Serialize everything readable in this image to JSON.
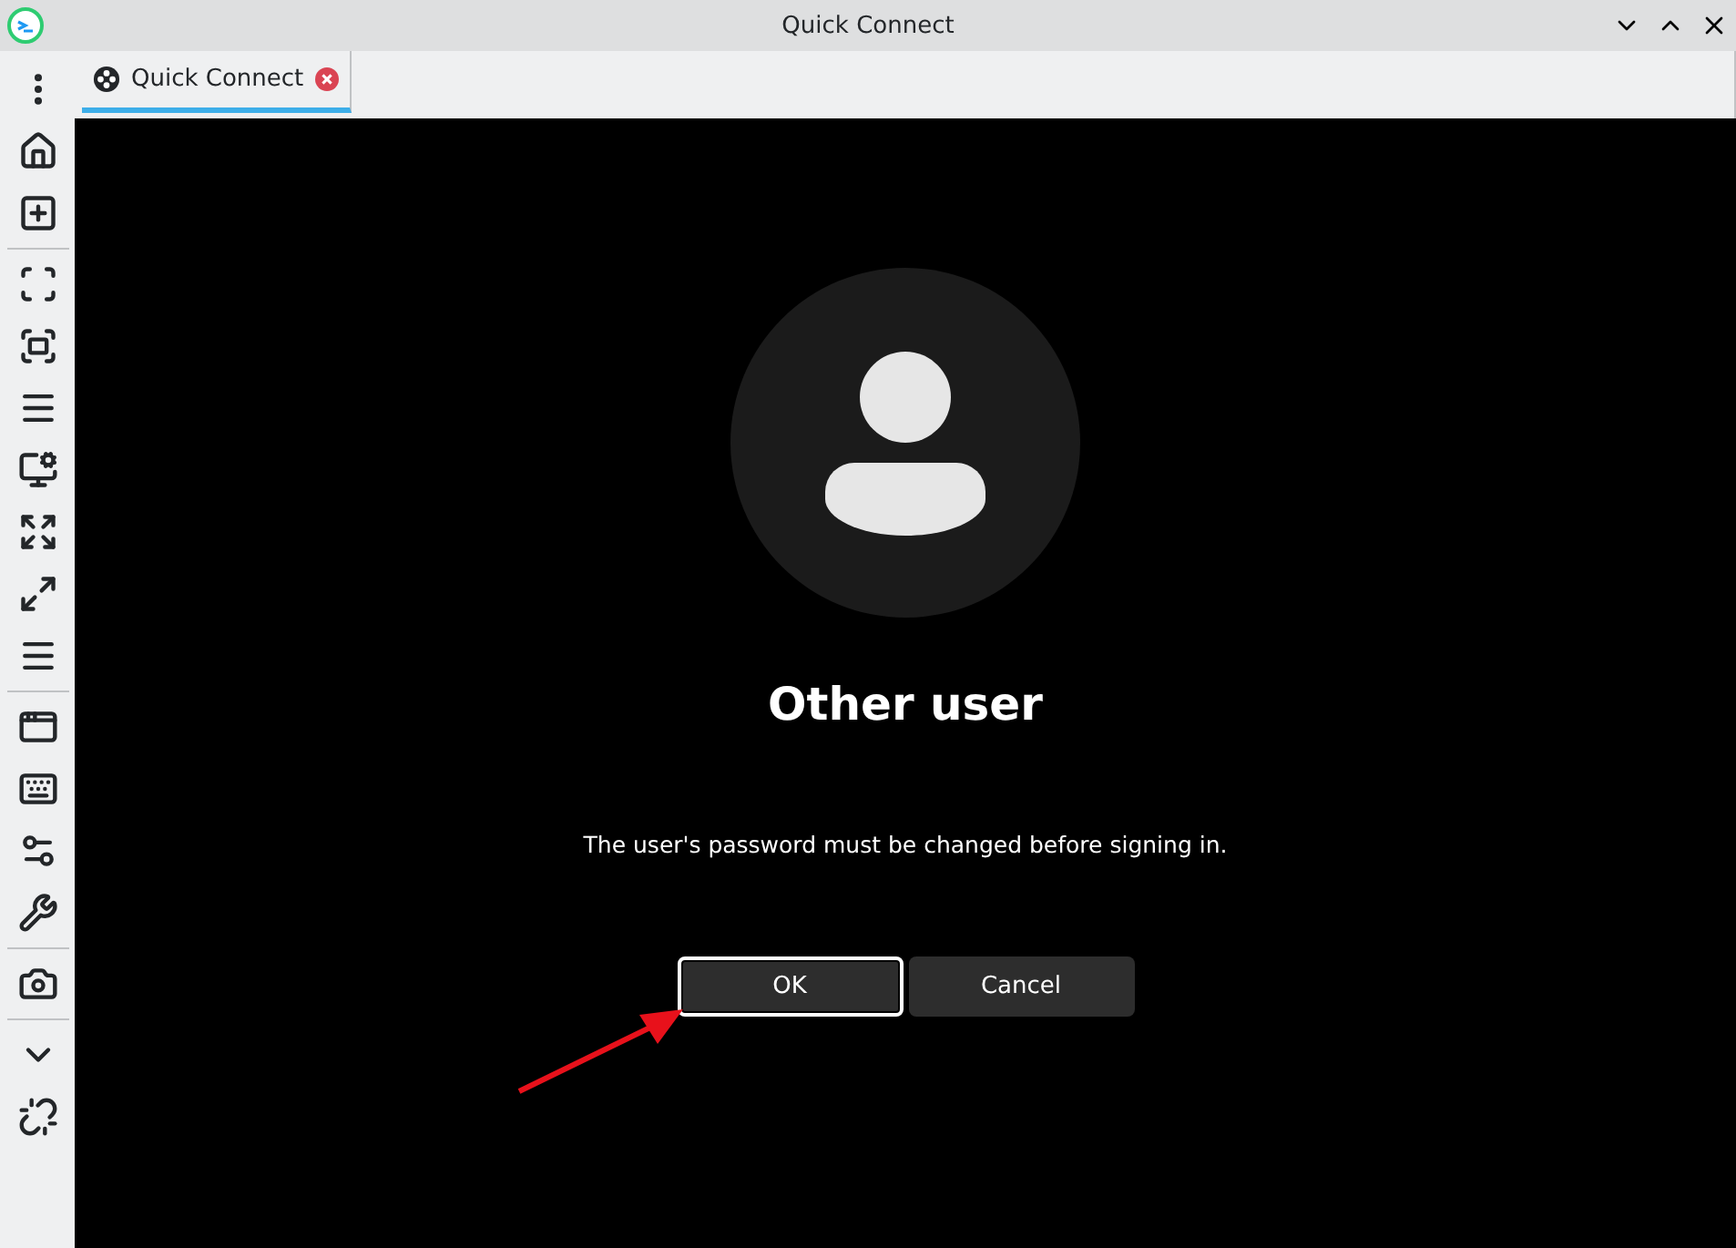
{
  "window": {
    "title": "Quick Connect"
  },
  "tabs": [
    {
      "label": "Quick Connect",
      "selected": true
    }
  ],
  "remote": {
    "user_name": "Other user",
    "message": "The user's password must be changed before signing in.",
    "buttons": [
      {
        "label": "OK",
        "selected": true
      },
      {
        "label": "Cancel",
        "selected": false
      }
    ]
  }
}
